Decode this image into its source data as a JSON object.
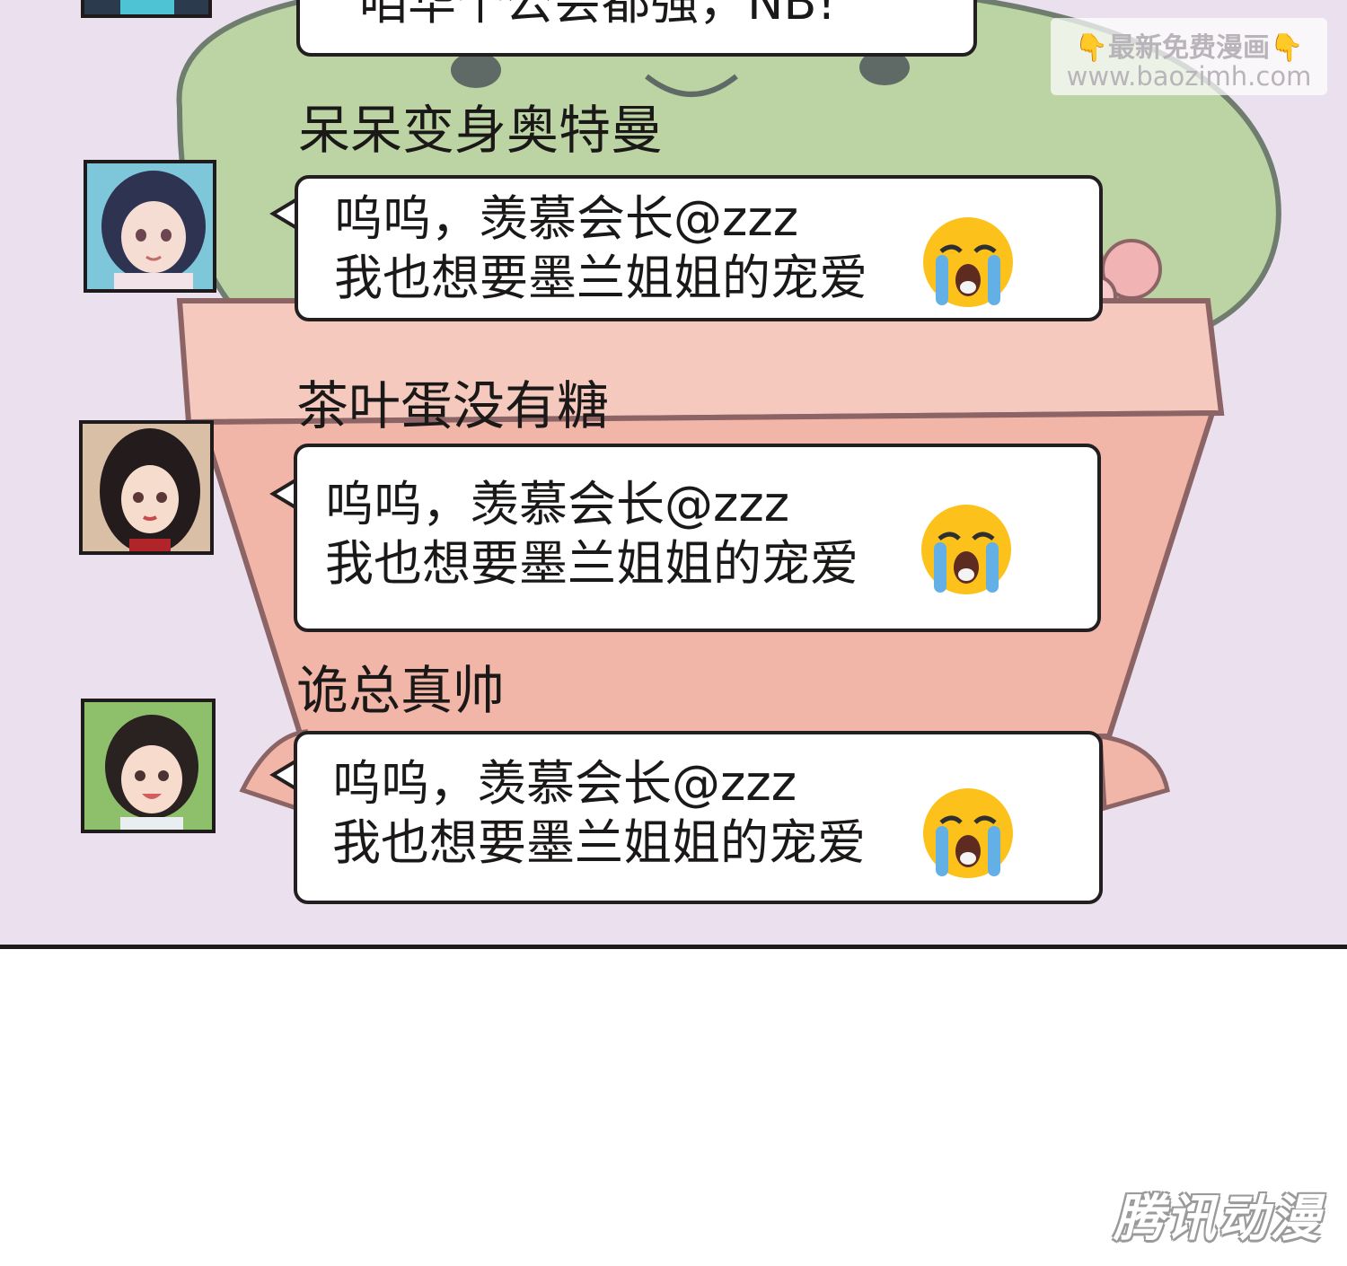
{
  "colors": {
    "panel_background": "#ebe0ee",
    "bubble_fill": "#ffffff",
    "outline": "#231f20"
  },
  "top_partial_message": "咱华个公会都强，NB!",
  "watermark": {
    "line1": "最新免费漫画",
    "line2": "www.baozimh.com",
    "icon": "pointing-down-hand-icon"
  },
  "messages": [
    {
      "sender": "呆呆变身奥特曼",
      "line1": "呜呜，羡慕会长@zzz",
      "line2": "我也想要墨兰姐姐的宠爱",
      "emoji": "loudly-crying-face-icon"
    },
    {
      "sender": "茶叶蛋没有糖",
      "line1": "呜呜，羡慕会长@zzz",
      "line2": "我也想要墨兰姐姐的宠爱",
      "emoji": "loudly-crying-face-icon"
    },
    {
      "sender": "诡总真帅",
      "line1": "呜呜，羡慕会长@zzz",
      "line2": "我也想要墨兰姐姐的宠爱",
      "emoji": "loudly-crying-face-icon"
    }
  ],
  "brand_logo": "腾讯动漫"
}
